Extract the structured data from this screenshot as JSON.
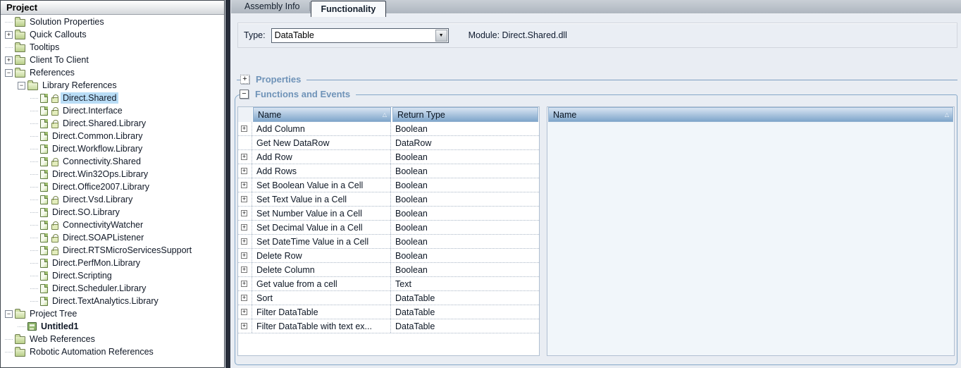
{
  "left_panel": {
    "title": "Project",
    "tree": [
      {
        "label": "Solution Properties",
        "level": 0,
        "icon": "folder",
        "expander": "none"
      },
      {
        "label": "Quick Callouts",
        "level": 0,
        "icon": "folder",
        "expander": "plus"
      },
      {
        "label": "Tooltips",
        "level": 0,
        "icon": "folder",
        "expander": "none"
      },
      {
        "label": "Client To Client",
        "level": 0,
        "icon": "folder",
        "expander": "plus"
      },
      {
        "label": "References",
        "level": 0,
        "icon": "folder-open",
        "expander": "minus"
      },
      {
        "label": "Library References",
        "level": 1,
        "icon": "folder-open",
        "expander": "minus"
      },
      {
        "label": "Direct.Shared",
        "level": 2,
        "icon": "page",
        "lock": true,
        "selected": true
      },
      {
        "label": "Direct.Interface",
        "level": 2,
        "icon": "page",
        "lock": true
      },
      {
        "label": "Direct.Shared.Library",
        "level": 2,
        "icon": "page",
        "lock": true
      },
      {
        "label": "Direct.Common.Library",
        "level": 2,
        "icon": "page"
      },
      {
        "label": "Direct.Workflow.Library",
        "level": 2,
        "icon": "page"
      },
      {
        "label": "Connectivity.Shared",
        "level": 2,
        "icon": "page",
        "lock": true
      },
      {
        "label": "Direct.Win32Ops.Library",
        "level": 2,
        "icon": "page"
      },
      {
        "label": "Direct.Office2007.Library",
        "level": 2,
        "icon": "page"
      },
      {
        "label": "Direct.Vsd.Library",
        "level": 2,
        "icon": "page",
        "lock": true
      },
      {
        "label": "Direct.SO.Library",
        "level": 2,
        "icon": "page"
      },
      {
        "label": "ConnectivityWatcher",
        "level": 2,
        "icon": "page",
        "lock": true
      },
      {
        "label": "Direct.SOAPListener",
        "level": 2,
        "icon": "page",
        "lock": true
      },
      {
        "label": "Direct.RTSMicroServicesSupport",
        "level": 2,
        "icon": "page",
        "lock": true
      },
      {
        "label": "Direct.PerfMon.Library",
        "level": 2,
        "icon": "page"
      },
      {
        "label": "Direct.Scripting",
        "level": 2,
        "icon": "page"
      },
      {
        "label": "Direct.Scheduler.Library",
        "level": 2,
        "icon": "page"
      },
      {
        "label": "Direct.TextAnalytics.Library",
        "level": 2,
        "icon": "page"
      },
      {
        "label": "Project Tree",
        "level": 0,
        "icon": "folder-open",
        "expander": "minus"
      },
      {
        "label": "Untitled1",
        "level": 1,
        "icon": "form",
        "bold": true
      },
      {
        "label": "Web References",
        "level": 0,
        "icon": "folder",
        "expander": "none"
      },
      {
        "label": "Robotic Automation References",
        "level": 0,
        "icon": "folder",
        "expander": "none"
      }
    ]
  },
  "tabs": [
    {
      "label": "Assembly Info",
      "active": false
    },
    {
      "label": "Functionality",
      "active": true
    }
  ],
  "type_row": {
    "label": "Type:",
    "value": "DataTable",
    "module_label": "Module:",
    "module_value": "Direct.Shared.dll"
  },
  "sections": {
    "properties": {
      "title": "Properties",
      "collapsed": true
    },
    "functions": {
      "title": "Functions and Events",
      "collapsed": false
    }
  },
  "functions_table": {
    "columns": [
      "Name",
      "Return Type"
    ],
    "rows": [
      {
        "name": "Add Column",
        "return_type": "Boolean",
        "expandable": true
      },
      {
        "name": "Get New DataRow",
        "return_type": "DataRow",
        "expandable": false
      },
      {
        "name": "Add Row",
        "return_type": "Boolean",
        "expandable": true
      },
      {
        "name": "Add Rows",
        "return_type": "Boolean",
        "expandable": true
      },
      {
        "name": "Set Boolean Value in a Cell",
        "return_type": "Boolean",
        "expandable": true
      },
      {
        "name": "Set Text Value in a Cell",
        "return_type": "Boolean",
        "expandable": true
      },
      {
        "name": "Set Number Value in a Cell",
        "return_type": "Boolean",
        "expandable": true
      },
      {
        "name": "Set Decimal Value in a Cell",
        "return_type": "Boolean",
        "expandable": true
      },
      {
        "name": "Set DateTime Value in a Cell",
        "return_type": "Boolean",
        "expandable": true
      },
      {
        "name": "Delete Row",
        "return_type": "Boolean",
        "expandable": true
      },
      {
        "name": "Delete Column",
        "return_type": "Boolean",
        "expandable": true
      },
      {
        "name": "Get value from a cell",
        "return_type": "Text",
        "expandable": true
      },
      {
        "name": "Sort",
        "return_type": "DataTable",
        "expandable": true
      },
      {
        "name": "Filter DataTable",
        "return_type": "DataTable",
        "expandable": true
      },
      {
        "name": "Filter DataTable with text ex...",
        "return_type": "DataTable",
        "expandable": true
      }
    ]
  },
  "events_table": {
    "columns": [
      "Name"
    ],
    "rows": []
  },
  "icons": {
    "expand": "+",
    "collapse": "−",
    "dropdown": "▼",
    "sort_asc": "△"
  },
  "colors": {
    "accent_title": "#6f93b8",
    "selection": "#b9ddf6",
    "grid_header_top": "#d8e4f2",
    "grid_header_bottom": "#7fa6cb",
    "group_border": "#85a8c9",
    "splitter": "#272d39",
    "content_bg": "#e9edf3"
  }
}
